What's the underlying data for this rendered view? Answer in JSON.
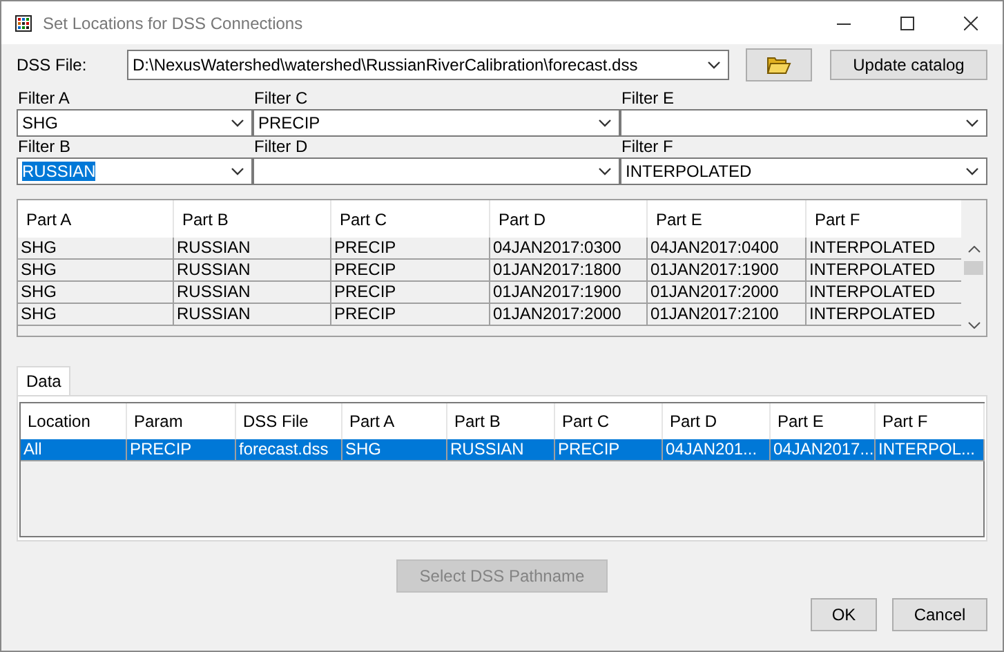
{
  "window": {
    "title": "Set Locations for DSS Connections"
  },
  "dss_file": {
    "label": "DSS File:",
    "value": "D:\\NexusWatershed\\watershed\\RussianRiverCalibration\\forecast.dss"
  },
  "update_button": {
    "label": "Update catalog"
  },
  "filters": [
    {
      "label": "Filter A",
      "value": "SHG",
      "text_selected": false
    },
    {
      "label": "Filter C",
      "value": "PRECIP",
      "text_selected": false
    },
    {
      "label": "Filter E"
    },
    {
      "label": "Filter B",
      "value": "RUSSIAN",
      "text_selected": true
    },
    {
      "label": "Filter D"
    },
    {
      "label": "Filter F",
      "value": "INTERPOLATED",
      "text_selected": false
    }
  ],
  "catalog_table": {
    "columns": [
      "Part A",
      "Part B",
      "Part C",
      "Part D",
      "Part E",
      "Part F"
    ],
    "rows": [
      [
        "SHG",
        "RUSSIAN",
        "PRECIP",
        "04JAN2017:0300",
        "04JAN2017:0400",
        "INTERPOLATED"
      ],
      [
        "SHG",
        "RUSSIAN",
        "PRECIP",
        "01JAN2017:1800",
        "01JAN2017:1900",
        "INTERPOLATED"
      ],
      [
        "SHG",
        "RUSSIAN",
        "PRECIP",
        "01JAN2017:1900",
        "01JAN2017:2000",
        "INTERPOLATED"
      ],
      [
        "SHG",
        "RUSSIAN",
        "PRECIP",
        "01JAN2017:2000",
        "01JAN2017:2100",
        "INTERPOLATED"
      ]
    ]
  },
  "tabs": [
    {
      "label": "Data",
      "selected": true
    }
  ],
  "data_table": {
    "columns": [
      "Location",
      "Param",
      "DSS File",
      "Part A",
      "Part B",
      "Part C",
      "Part D",
      "Part E",
      "Part F"
    ],
    "rows": [
      {
        "cells": [
          "All",
          "PRECIP",
          "forecast.dss",
          "SHG",
          "RUSSIAN",
          "PRECIP",
          "04JAN201...",
          "04JAN2017...",
          "INTERPOL..."
        ],
        "selected": true
      }
    ]
  },
  "select_button": {
    "label": "Select DSS Pathname",
    "disabled": true
  },
  "buttons": [
    "OK",
    "Cancel"
  ]
}
